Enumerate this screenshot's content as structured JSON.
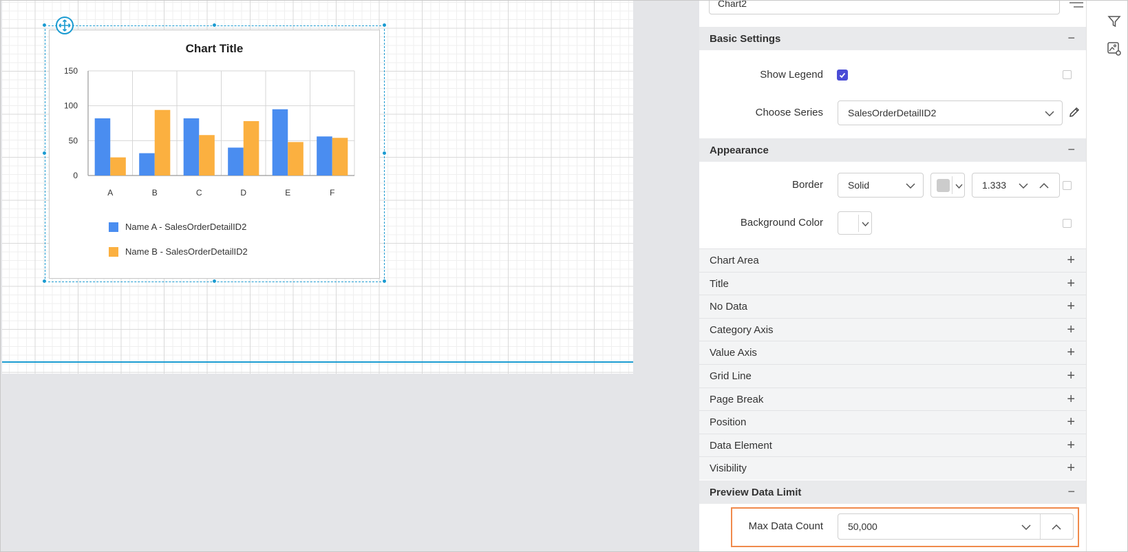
{
  "chart": {
    "title": "Chart Title",
    "y_ticks": [
      "150",
      "100",
      "50",
      "0"
    ],
    "legend": [
      {
        "label": "Name A - SalesOrderDetailID2",
        "color": "#4a8df0"
      },
      {
        "label": "Name B - SalesOrderDetailID2",
        "color": "#fbb040"
      }
    ]
  },
  "chart_data": {
    "type": "bar",
    "title": "Chart Title",
    "categories": [
      "A",
      "B",
      "C",
      "D",
      "E",
      "F"
    ],
    "series": [
      {
        "name": "Name A - SalesOrderDetailID2",
        "color": "#4a8df0",
        "values": [
          82,
          32,
          82,
          40,
          95,
          56
        ]
      },
      {
        "name": "Name B - SalesOrderDetailID2",
        "color": "#fbb040",
        "values": [
          26,
          94,
          58,
          78,
          48,
          54
        ]
      }
    ],
    "ylim": [
      0,
      150
    ],
    "yticks": [
      0,
      50,
      100,
      150
    ],
    "grid": true,
    "legend_position": "bottom-left"
  },
  "panel": {
    "name_value": "Chart2",
    "basic_settings": {
      "title": "Basic Settings",
      "toggle": "−",
      "show_legend_label": "Show Legend",
      "show_legend_checked": true,
      "choose_series_label": "Choose Series",
      "choose_series_value": "SalesOrderDetailID2"
    },
    "appearance": {
      "title": "Appearance",
      "toggle": "−",
      "border_label": "Border",
      "border_style": "Solid",
      "border_color": "#cccccc",
      "border_width": "1.333",
      "bg_label": "Background Color"
    },
    "collapsed": [
      "Chart Area",
      "Title",
      "No Data",
      "Category Axis",
      "Value Axis",
      "Grid Line",
      "Page Break",
      "Position",
      "Data Element",
      "Visibility"
    ],
    "collapsed_toggle": "+",
    "preview": {
      "title": "Preview Data Limit",
      "toggle": "−",
      "max_label": "Max Data Count",
      "max_value": "50,000",
      "highlight_color": "#f08a4b"
    }
  },
  "icons": {
    "filter": "filter-icon",
    "image_settings": "image-settings-icon",
    "move": "move-icon",
    "edit": "pencil-icon",
    "more": "list-menu-icon"
  },
  "colors": {
    "accent": "#1b9bd1",
    "checkbox": "#4a4cd6"
  }
}
